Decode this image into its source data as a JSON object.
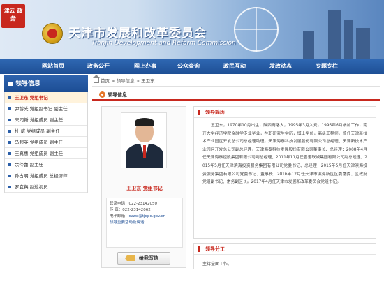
{
  "header": {
    "stamp_text": "津云 政务",
    "title": "天津市发展和改革委员会",
    "subtitle": "Tianjin Development and Reform Commission"
  },
  "nav": {
    "items": [
      {
        "label": "网站首页"
      },
      {
        "label": "政务公开"
      },
      {
        "label": "网上办事"
      },
      {
        "label": "公众查询"
      },
      {
        "label": "政民互动"
      },
      {
        "label": "发改动态"
      },
      {
        "label": "专题专栏"
      }
    ]
  },
  "sidebar": {
    "title": "领导信息",
    "items": [
      {
        "label": "王卫东  党组书记",
        "active": true
      },
      {
        "label": "尹龄光  党组副书记  副主任"
      },
      {
        "label": "宋同新  党组成员  副主任"
      },
      {
        "label": "杜   威  党组成员  副主任"
      },
      {
        "label": "马超英  党组成员  副主任"
      },
      {
        "label": "王真惠  党组成员  副主任"
      },
      {
        "label": "余伶蕾  副主任"
      },
      {
        "label": "孙占明  党组成员  总经济师"
      },
      {
        "label": "罗宜英  副巡视员"
      }
    ]
  },
  "breadcrumb": "首页 > 领导信息 > 王卫东",
  "tab_label": "领导信息",
  "profile": {
    "name_title": "王卫东  党组书记",
    "contact_phone": "联系电话：022-23142050",
    "contact_fax": "传    真：022-23142062",
    "contact_email_label": "电子邮箱：",
    "contact_email": "dzzw@tjdpc.gov.cn",
    "contact_link": "领导重要活动及讲话",
    "mail_button": "给我写信"
  },
  "bio_panel": {
    "title": "领导简历",
    "text": "王卫东，1970年10月出生，陕西商洛人，1995年3月入党，1995年6月参加工作，南开大学经济学院金融学专业毕业，在职研究生学历，博士学位，高级工程师。曾任天津新技术产业园区开发总公司总经理助理，天津海泰科技发展股份有限公司总经理；天津新技术产业园区开发总公司副总经理，天津海泰科技发展股份有限公司董事长、总经理；2008年4月任天津海泰控股集团有限公司副总经理；2011年11月任香港联城集团有限公司副总经理；2015年5月任天津滨海投资服务集团有限公司党委书记、总经理；2015年5月任天津滨海投资服务集团有限公司党委书记、董事长；2016年12月任天津市滨海新区区委常委、区政府党组副书记、常务副区长。2017年4月任天津市发展和改革委员会党组书记。"
  },
  "duty_panel": {
    "title": "领导分工",
    "text": "主持全面工作。"
  },
  "colors": {
    "nav_blue": "#1e4f95",
    "accent_red": "#c8281e",
    "orange": "#e5762a"
  }
}
